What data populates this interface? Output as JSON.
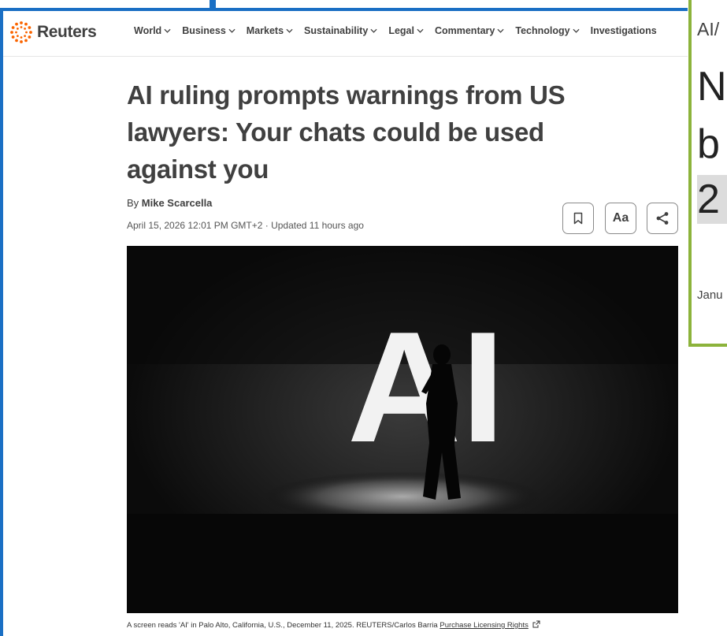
{
  "site": {
    "logo_text": "Reuters",
    "nav": [
      "World",
      "Business",
      "Markets",
      "Sustainability",
      "Legal",
      "Commentary",
      "Technology",
      "Investigations"
    ]
  },
  "article": {
    "headline": "AI ruling prompts warnings from US lawyers: Your chats could be used against you",
    "byline_prefix": "By",
    "author": "Mike Scarcella",
    "dateline": "April 15, 2026 12:01 PM GMT+2 · Updated 11 hours ago",
    "text_size_label": "Aa",
    "photo_text": "AI",
    "caption": "A screen reads 'AI' in Palo Alto, California, U.S., December 11, 2025. REUTERS/Carlos Barria",
    "caption_link": "Purchase Licensing Rights"
  },
  "right_panel": {
    "kicker": "AI/",
    "line1": "N",
    "line2": "b",
    "line3": "2",
    "date": "Janu"
  },
  "colors": {
    "left_frame": "#1a6fc4",
    "right_frame": "#8cb33b",
    "logo_accent": "#fa6400"
  }
}
